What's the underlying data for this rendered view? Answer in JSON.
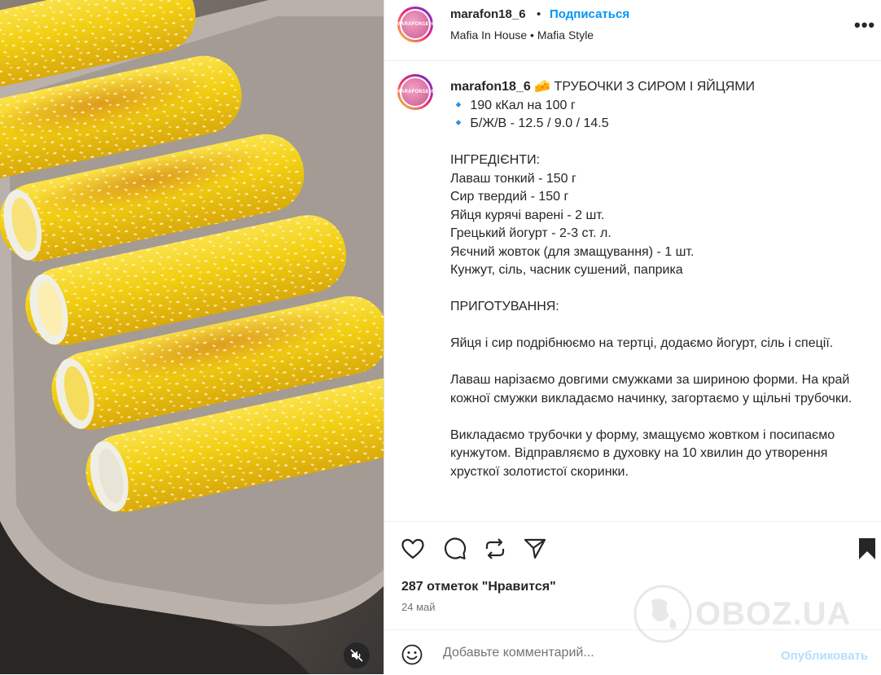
{
  "post": {
    "username": "marafon18_6",
    "separator": "•",
    "follow_label": "Подписаться",
    "subtitle": "Mafia In House • Mafia Style",
    "more_label": "•••",
    "avatar_text": "MARAFON18_6"
  },
  "caption": {
    "username": "marafon18_6",
    "title_emoji": "🧀",
    "title": "ТРУБОЧКИ З СИРОМ І ЯЙЦЯМИ",
    "lines": [
      "🔹 190 кКал на 100 г",
      "🔹 Б/Ж/В - 12.5 / 9.0 / 14.5",
      "",
      "ІНГРЕДІЄНТИ:",
      "Лаваш тонкий - 150 г",
      "Сир твердий - 150 г",
      "Яйця курячі варені - 2 шт.",
      "Грецький йогурт - 2-3 ст. л.",
      "Яєчний жовток (для змащування) - 1 шт.",
      "Кунжут, сіль, часник сушений, паприка",
      "",
      "ПРИГОТУВАННЯ:",
      "",
      "Яйця і сир подрібнюємо на тертці, додаємо йогурт, сіль і спеції.",
      "",
      "Лаваш нарізаємо довгими смужками за шириною форми. На край кожної смужки викладаємо начинку, загортаємо у щільні трубочки.",
      "",
      "Викладаємо трубочки у форму, змащуємо жовтком і посипаємо кунжутом. Відправляємо в духовку на 10 хвилин до утворення хрусткої золотистої скоринки."
    ]
  },
  "engagement": {
    "likes": "287 отметок \"Нравится\"",
    "date": "24 май"
  },
  "comment": {
    "placeholder": "Добавьте комментарий...",
    "publish_label": "Опубликовать"
  },
  "watermark": {
    "text": "OBOZ.UA"
  },
  "icons": {
    "like": "heart-icon",
    "comment": "comment-bubble-icon",
    "repost": "repost-icon",
    "share": "paper-plane-icon",
    "save": "bookmark-icon",
    "emoji": "smiley-icon",
    "mute": "speaker-muted-icon"
  },
  "colors": {
    "accent": "#0095f6",
    "publish_disabled": "#b2dffc",
    "text": "#262626",
    "secondary": "#737373",
    "roll_yellow": "#f5d21a"
  }
}
